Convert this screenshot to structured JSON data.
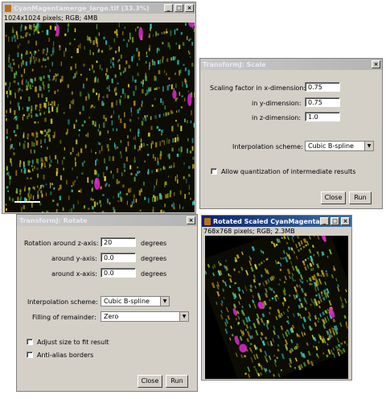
{
  "image_window": {
    "title": "CyanMagentamerge_large.tif (33.3%)",
    "info": "1024x1024 pixels; RGB; 4MB",
    "controls": {
      "minimize": "_",
      "maximize": "□",
      "close": "×"
    }
  },
  "scale_dialog": {
    "title": "TransformJ: Scale",
    "fields": [
      {
        "label": "Scaling factor in x-dimension:",
        "value": "0.75"
      },
      {
        "label": "in y-dimension:",
        "value": "0.75"
      },
      {
        "label": "in z-dimension:",
        "value": "1.0"
      }
    ],
    "interpolation_label": "Interpolation scheme:",
    "interpolation_value": "Cubic B-spline",
    "checkbox_label": "Allow quantization of intermediate results",
    "close_label": "Close",
    "run_label": "Run",
    "close_x": "×"
  },
  "rotate_dialog": {
    "title": "TransformJ: Rotate",
    "fields": [
      {
        "label": "Rotation around z-axis:",
        "value": "20",
        "unit": "degrees"
      },
      {
        "label": "around y-axis:",
        "value": "0.0",
        "unit": "degrees"
      },
      {
        "label": "around x-axis:",
        "value": "0.0",
        "unit": "degrees"
      }
    ],
    "interpolation_label": "Interpolation scheme:",
    "interpolation_value": "Cubic B-spline",
    "filling_label": "Filling of remainder:",
    "filling_value": "Zero",
    "checkbox1_label": "Adjust size to fit result",
    "checkbox2_label": "Anti-alias borders",
    "close_label": "Close",
    "run_label": "Run",
    "close_x": "×"
  },
  "result_window": {
    "title": "Rotated Scaled CyanMagentam...",
    "info": "768x768 pixels; RGB; 2.3MB",
    "controls": {
      "minimize": "_",
      "maximize": "□",
      "close": "×"
    }
  },
  "colors": {
    "dialog_bg": "#d4d0c8",
    "active_title": "#0a246a",
    "inactive_title": "#b4b4b4",
    "image_bg": "#0c0c04"
  }
}
